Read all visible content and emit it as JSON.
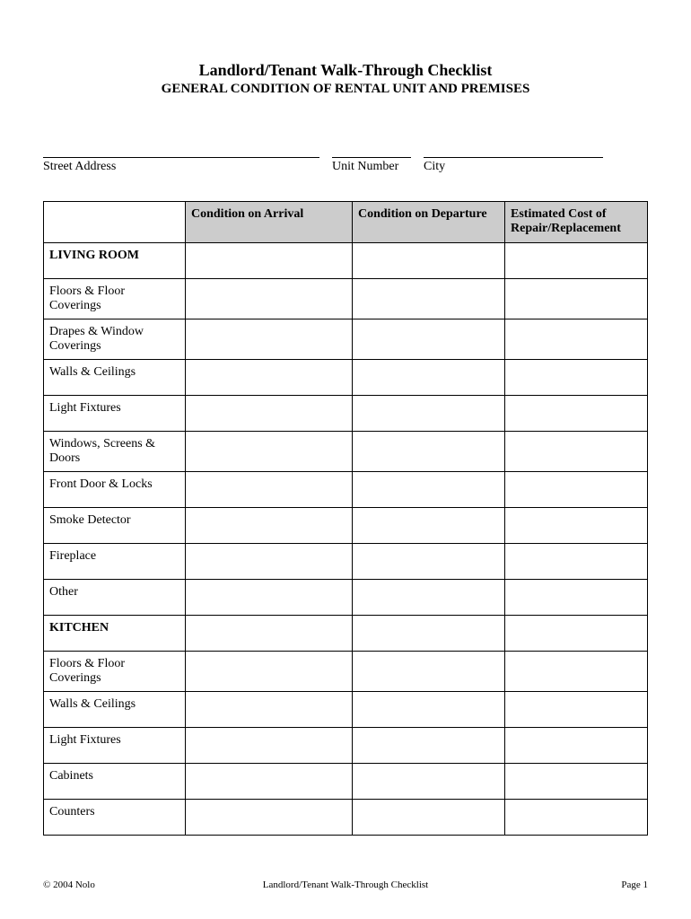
{
  "title": "Landlord/Tenant Walk-Through Checklist",
  "subtitle": "GENERAL CONDITION OF RENTAL UNIT AND PREMISES",
  "address_labels": {
    "street": "Street Address",
    "unit": "Unit Number",
    "city": "City"
  },
  "table": {
    "headers": {
      "col1": "",
      "col2": "Condition on Arrival",
      "col3": "Condition on Departure",
      "col4": "Estimated Cost of Repair/Replacement"
    },
    "rows": [
      {
        "label": "LIVING ROOM",
        "section": true
      },
      {
        "label": "Floors & Floor Coverings",
        "section": false
      },
      {
        "label": "Drapes & Window Coverings",
        "section": false
      },
      {
        "label": "Walls & Ceilings",
        "section": false
      },
      {
        "label": "Light Fixtures",
        "section": false
      },
      {
        "label": "Windows, Screens & Doors",
        "section": false
      },
      {
        "label": "Front Door & Locks",
        "section": false
      },
      {
        "label": "Smoke Detector",
        "section": false
      },
      {
        "label": "Fireplace",
        "section": false
      },
      {
        "label": "Other",
        "section": false
      },
      {
        "label": "KITCHEN",
        "section": true
      },
      {
        "label": "Floors & Floor Coverings",
        "section": false
      },
      {
        "label": "Walls & Ceilings",
        "section": false
      },
      {
        "label": "Light Fixtures",
        "section": false
      },
      {
        "label": "Cabinets",
        "section": false
      },
      {
        "label": "Counters",
        "section": false
      }
    ]
  },
  "footer": {
    "copyright": "© 2004 Nolo",
    "center": "Landlord/Tenant Walk-Through Checklist",
    "page": "Page 1"
  }
}
